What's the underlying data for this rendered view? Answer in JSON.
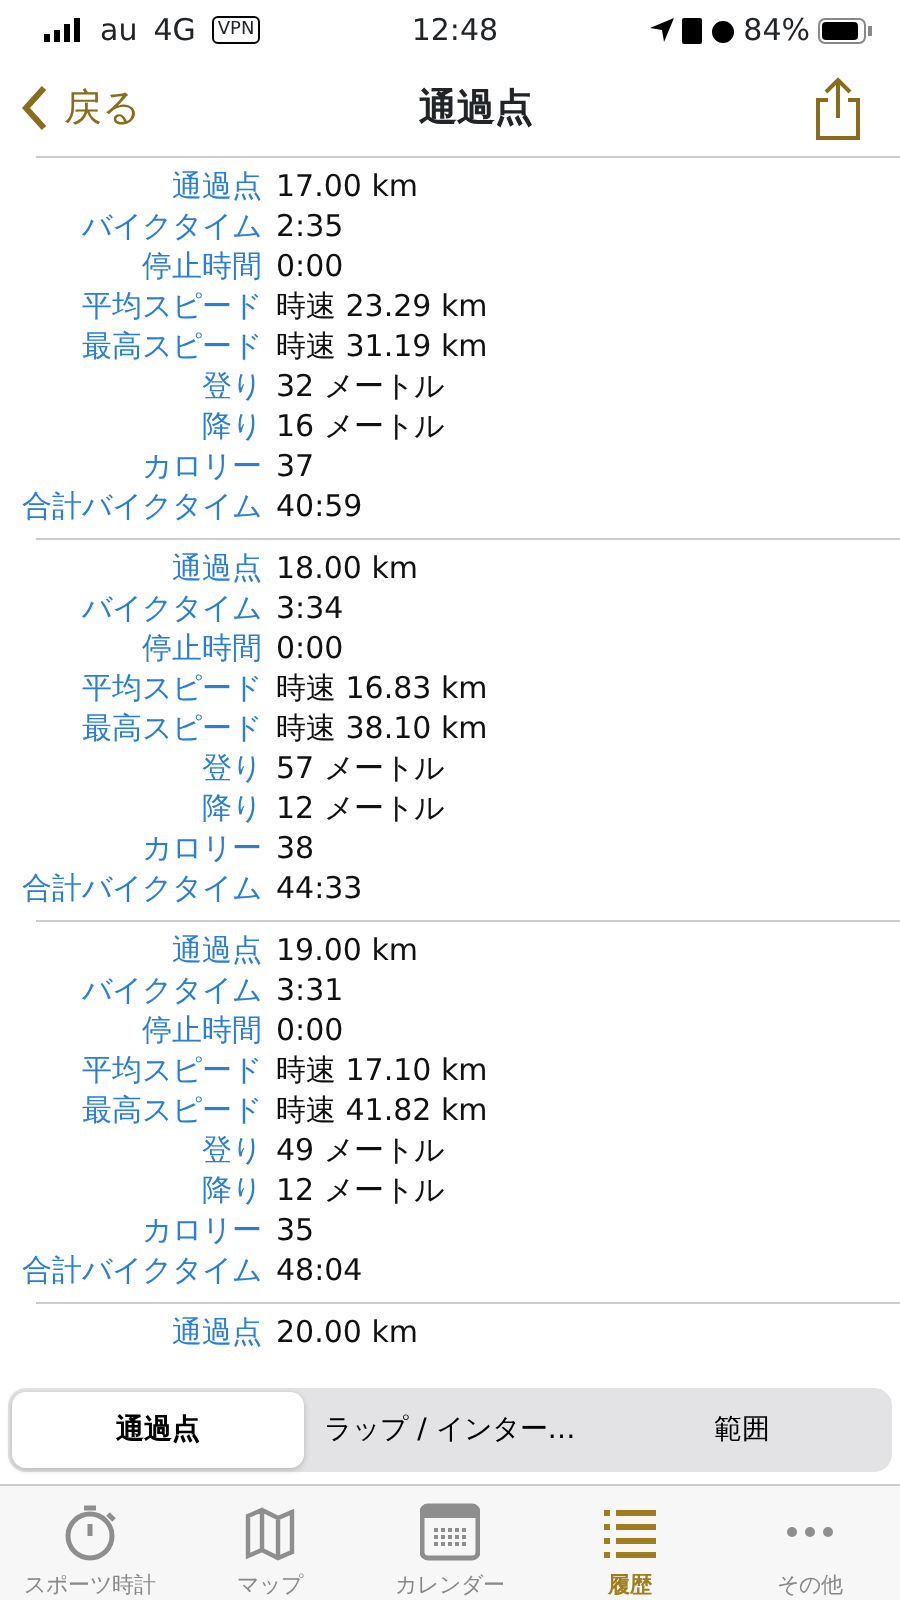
{
  "status_bar": {
    "carrier": "au",
    "network": "4G",
    "vpn": "VPN",
    "time": "12:48",
    "battery": "84%"
  },
  "nav": {
    "back": "戻る",
    "title": "通過点"
  },
  "checkpoints": [
    {
      "rows": [
        {
          "label": "通過点",
          "value": "17.00 km"
        },
        {
          "label": "バイクタイム",
          "value": "2:35"
        },
        {
          "label": "停止時間",
          "value": "0:00"
        },
        {
          "label": "平均スピード",
          "value": "時速 23.29 km"
        },
        {
          "label": "最高スピード",
          "value": "時速 31.19 km"
        },
        {
          "label": "登り",
          "value": "32 メートル"
        },
        {
          "label": "降り",
          "value": "16 メートル"
        },
        {
          "label": "カロリー",
          "value": "37"
        },
        {
          "label": "合計バイクタイム",
          "value": "40:59"
        }
      ]
    },
    {
      "rows": [
        {
          "label": "通過点",
          "value": "18.00 km"
        },
        {
          "label": "バイクタイム",
          "value": "3:34"
        },
        {
          "label": "停止時間",
          "value": "0:00"
        },
        {
          "label": "平均スピード",
          "value": "時速 16.83 km"
        },
        {
          "label": "最高スピード",
          "value": "時速 38.10 km"
        },
        {
          "label": "登り",
          "value": "57 メートル"
        },
        {
          "label": "降り",
          "value": "12 メートル"
        },
        {
          "label": "カロリー",
          "value": "38"
        },
        {
          "label": "合計バイクタイム",
          "value": "44:33"
        }
      ]
    },
    {
      "rows": [
        {
          "label": "通過点",
          "value": "19.00 km"
        },
        {
          "label": "バイクタイム",
          "value": "3:31"
        },
        {
          "label": "停止時間",
          "value": "0:00"
        },
        {
          "label": "平均スピード",
          "value": "時速 17.10 km"
        },
        {
          "label": "最高スピード",
          "value": "時速 41.82 km"
        },
        {
          "label": "登り",
          "value": "49 メートル"
        },
        {
          "label": "降り",
          "value": "12 メートル"
        },
        {
          "label": "カロリー",
          "value": "35"
        },
        {
          "label": "合計バイクタイム",
          "value": "48:04"
        }
      ]
    },
    {
      "rows": [
        {
          "label": "通過点",
          "value": "20.00 km"
        }
      ]
    }
  ],
  "segments": [
    {
      "label": "通過点",
      "selected": true
    },
    {
      "label": "ラップ / インター…",
      "selected": false
    },
    {
      "label": "範囲",
      "selected": false
    }
  ],
  "tab_bar": [
    {
      "label": "スポーツ時計",
      "kind": "stopwatch",
      "selected": false
    },
    {
      "label": "マップ",
      "kind": "map",
      "selected": false
    },
    {
      "label": "カレンダー",
      "kind": "calendar",
      "selected": false
    },
    {
      "label": "履歴",
      "kind": "list",
      "selected": true
    },
    {
      "label": "その他",
      "kind": "more",
      "selected": false
    }
  ]
}
